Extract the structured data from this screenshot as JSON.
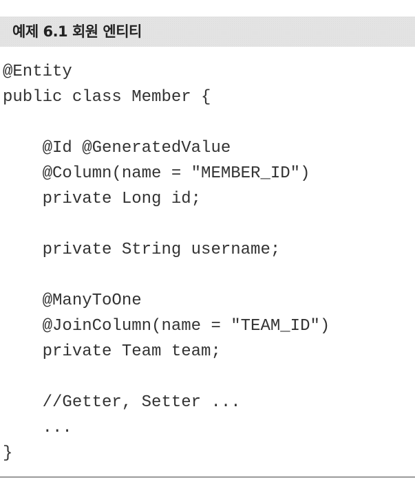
{
  "caption": {
    "title": "예제 6.1 회원 엔티티"
  },
  "code": {
    "lines": [
      "@Entity",
      "public class Member {",
      "",
      "    @Id @GeneratedValue",
      "    @Column(name = \"MEMBER_ID\")",
      "    private Long id;",
      "",
      "    private String username;",
      "",
      "    @ManyToOne",
      "    @JoinColumn(name = \"TEAM_ID\")",
      "    private Team team;",
      "",
      "    //Getter, Setter ...",
      "    ...",
      "}"
    ]
  }
}
